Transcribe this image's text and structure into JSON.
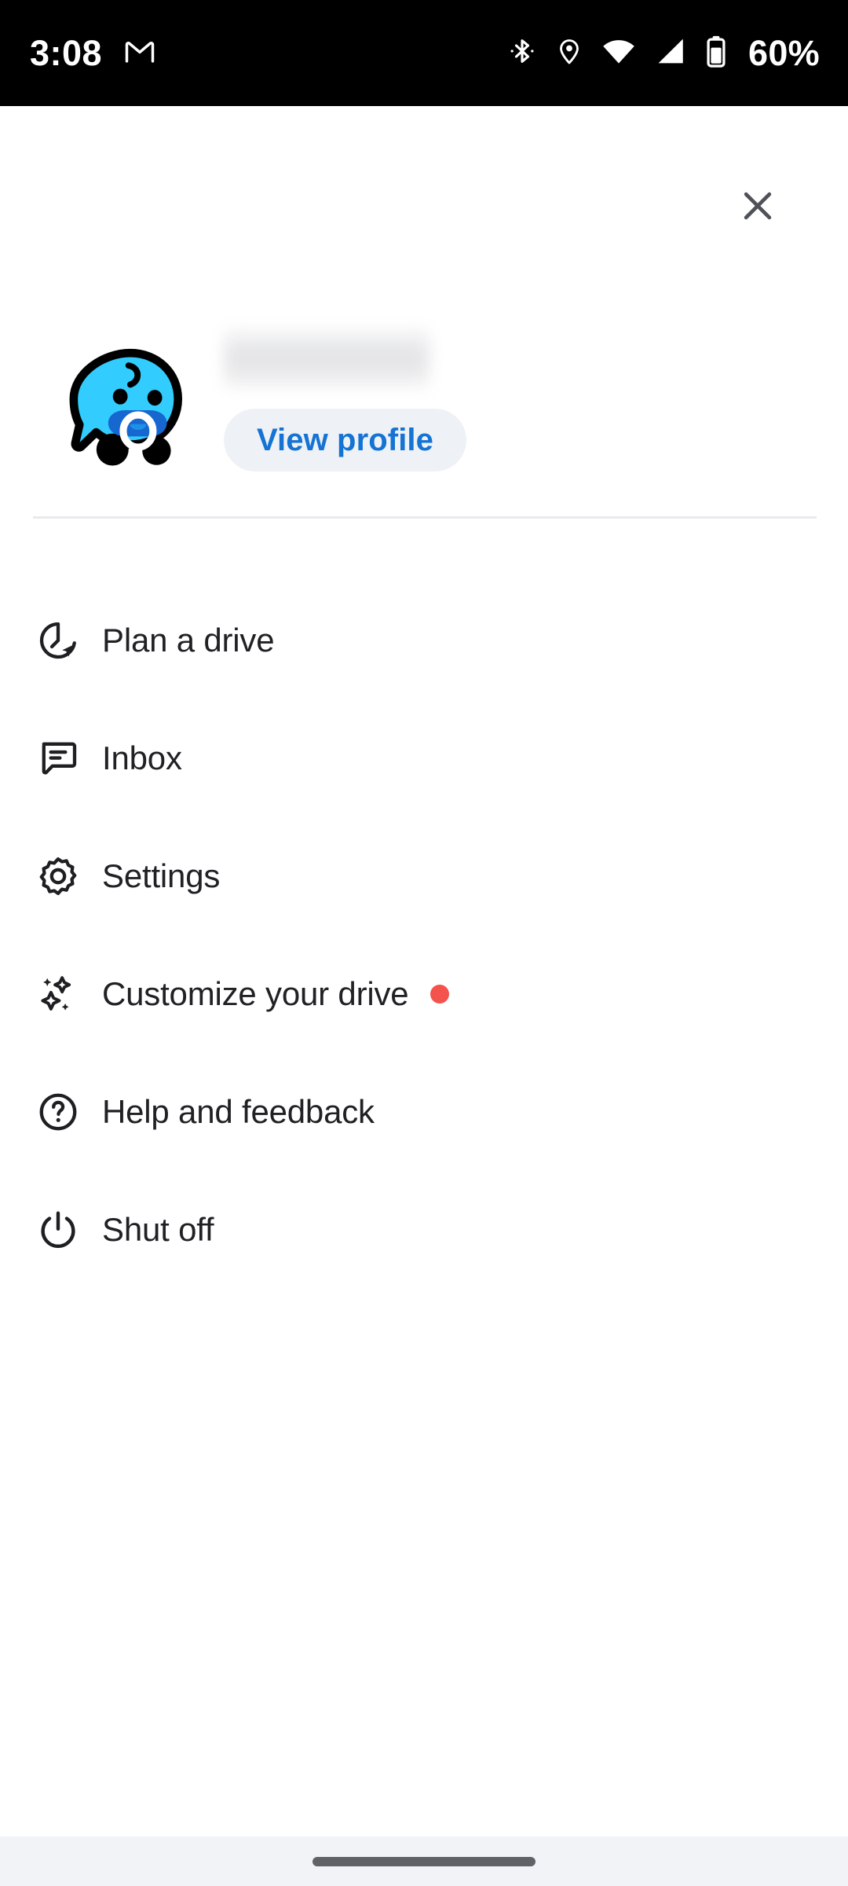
{
  "status_bar": {
    "clock": "3:08",
    "battery_percent": "60%",
    "icons": {
      "notification": "gmail-icon",
      "bluetooth": "bluetooth-icon",
      "location": "location-pin-icon",
      "wifi": "wifi-icon",
      "signal": "cellular-signal-icon",
      "battery": "battery-icon"
    },
    "colors": {
      "background": "#000000",
      "foreground": "#ffffff"
    }
  },
  "header": {
    "close_icon": "close-icon"
  },
  "profile": {
    "avatar_icon": "waze-baby-mood-avatar",
    "username": "",
    "username_state": "blurred",
    "view_profile_label": "View profile",
    "view_profile_text_color": "#1473d3",
    "view_profile_bg_color": "#eef1f6"
  },
  "menu": {
    "items": [
      {
        "label": "Plan a drive",
        "icon": "clock-navigation-icon",
        "badge": false
      },
      {
        "label": "Inbox",
        "icon": "message-bubble-icon",
        "badge": false
      },
      {
        "label": "Settings",
        "icon": "gear-icon",
        "badge": false
      },
      {
        "label": "Customize your drive",
        "icon": "sparkles-icon",
        "badge": true
      },
      {
        "label": "Help and feedback",
        "icon": "question-circle-icon",
        "badge": false
      },
      {
        "label": "Shut off",
        "icon": "power-icon",
        "badge": false
      }
    ],
    "badge_color": "#f4524d",
    "text_color": "#202124"
  },
  "nav_bar": {
    "handle": "gesture-home-handle",
    "background": "#f1f3f6"
  }
}
